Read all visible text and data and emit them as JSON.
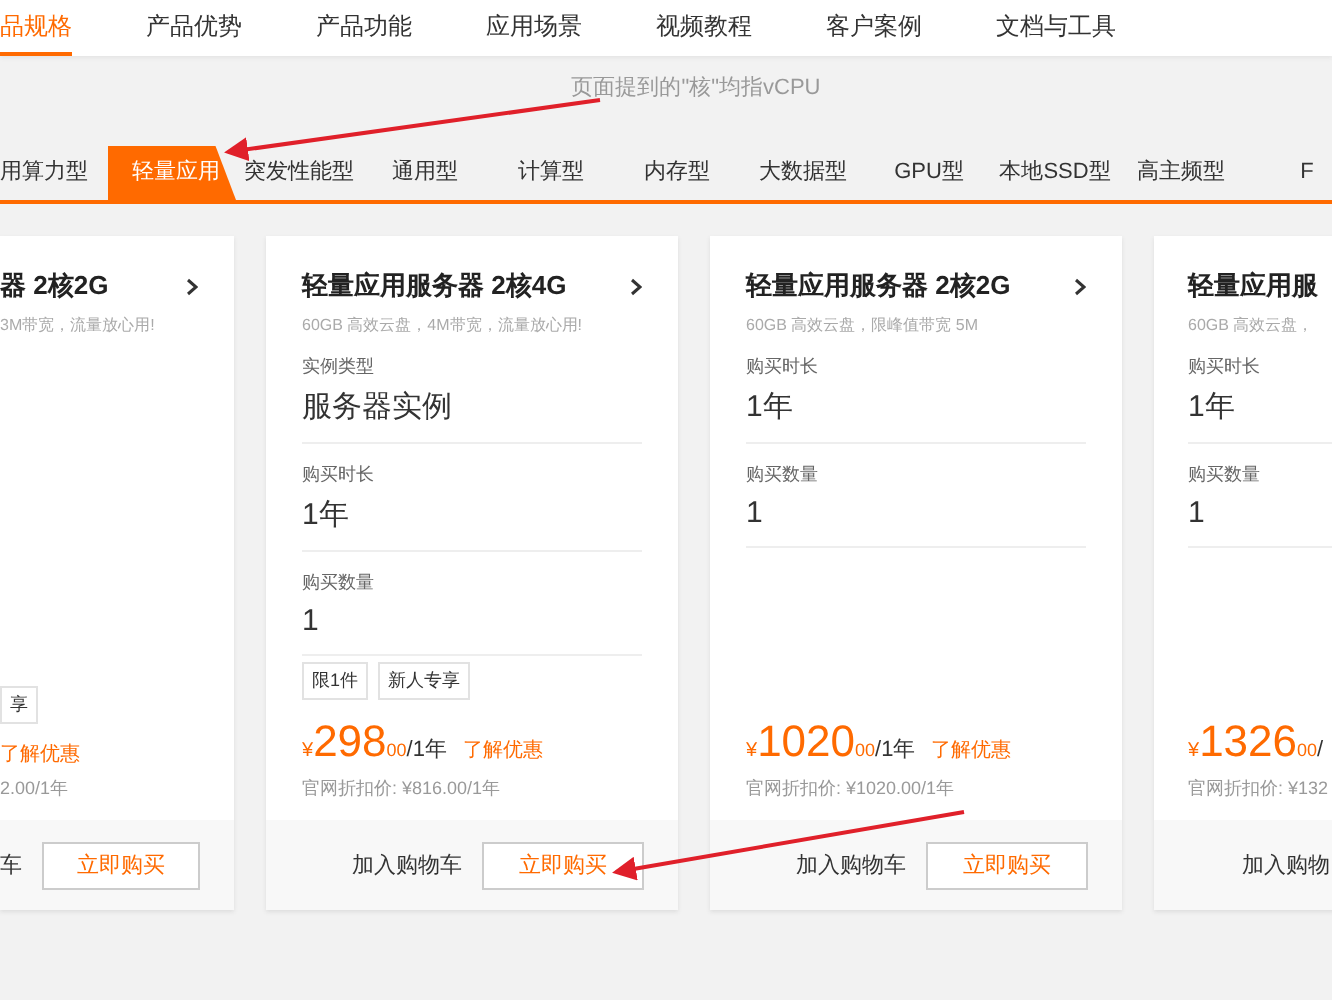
{
  "nav_tabs": [
    {
      "label": "品规格",
      "selected": true
    },
    {
      "label": "产品优势",
      "selected": false
    },
    {
      "label": "产品功能",
      "selected": false
    },
    {
      "label": "应用场景",
      "selected": false
    },
    {
      "label": "视频教程",
      "selected": false
    },
    {
      "label": "客户案例",
      "selected": false
    },
    {
      "label": "文档与工具",
      "selected": false
    }
  ],
  "note": "页面提到的\"核\"均指vCPU",
  "category_tabs": [
    {
      "label": "用算力型",
      "selected": false
    },
    {
      "label": "轻量应用",
      "selected": true
    },
    {
      "label": "突发性能型",
      "selected": false
    },
    {
      "label": "通用型",
      "selected": false
    },
    {
      "label": "计算型",
      "selected": false
    },
    {
      "label": "内存型",
      "selected": false
    },
    {
      "label": "大数据型",
      "selected": false
    },
    {
      "label": "GPU型",
      "selected": false
    },
    {
      "label": "本地SSD型",
      "selected": false
    },
    {
      "label": "高主频型",
      "selected": false
    },
    {
      "label": "F",
      "selected": false
    }
  ],
  "cards": [
    {
      "kind": "cut-left",
      "title": "器 2核2G",
      "subtitle": "3M带宽，流量放心用!",
      "tags": [
        "享"
      ],
      "promo_link": "了解优惠",
      "original_price": "2.00/1年",
      "cart_link": "车",
      "buy_button": "立即购买"
    },
    {
      "kind": "full",
      "title": "轻量应用服务器 2核4G",
      "subtitle": "60GB 高效云盘，4M带宽，流量放心用!",
      "specs": [
        {
          "label": "实例类型",
          "value": "服务器实例"
        },
        {
          "label": "购买时长",
          "value": "1年"
        },
        {
          "label": "购买数量",
          "value": "1"
        }
      ],
      "tags": [
        "限1件",
        "新人专享"
      ],
      "price": {
        "currency": "¥",
        "amount": "298",
        "decimals": "00",
        "period": "/1年"
      },
      "promo_link": "了解优惠",
      "original_price": "官网折扣价: ¥816.00/1年",
      "cart_link": "加入购物车",
      "buy_button": "立即购买"
    },
    {
      "kind": "full",
      "title": "轻量应用服务器 2核2G",
      "subtitle": "60GB 高效云盘，限峰值带宽 5M",
      "specs": [
        {
          "label": "购买时长",
          "value": "1年"
        },
        {
          "label": "购买数量",
          "value": "1"
        }
      ],
      "price": {
        "currency": "¥",
        "amount": "1020",
        "decimals": "00",
        "period": "/1年"
      },
      "promo_link": "了解优惠",
      "original_price": "官网折扣价: ¥1020.00/1年",
      "cart_link": "加入购物车",
      "buy_button": "立即购买"
    },
    {
      "kind": "cut-right",
      "title": "轻量应用服",
      "subtitle": "60GB 高效云盘，",
      "specs": [
        {
          "label": "购买时长",
          "value": "1年"
        },
        {
          "label": "购买数量",
          "value": "1"
        }
      ],
      "price": {
        "currency": "¥",
        "amount": "1326",
        "decimals": "00",
        "period": "/"
      },
      "original_price": "官网折扣价: ¥132",
      "cart_link": "加入购物"
    }
  ]
}
